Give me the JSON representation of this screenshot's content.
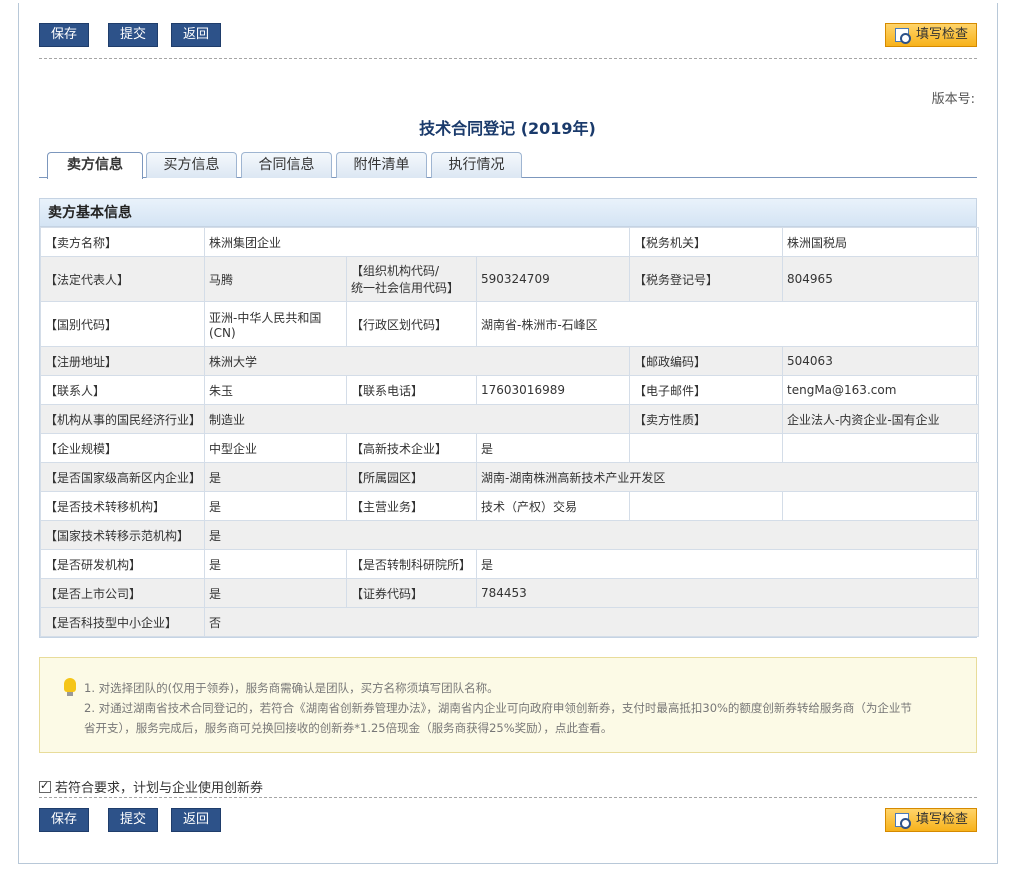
{
  "toolbar": {
    "save": "保存",
    "submit": "提交",
    "back": "返回",
    "check": "填写检查"
  },
  "version_label": "版本号:",
  "title": "技术合同登记 (2019年)",
  "tabs": [
    "卖方信息",
    "买方信息",
    "合同信息",
    "附件清单",
    "执行情况"
  ],
  "panel_title": "卖方基本信息",
  "rows": {
    "r1": {
      "l1": "【卖方名称】",
      "v1": "株洲集团企业",
      "l2": "【税务机关】",
      "v2": "株洲国税局"
    },
    "r2": {
      "l1": "【法定代表人】",
      "v1": "马腾",
      "l2a": "【组织机构代码/",
      "l2b": "统一社会信用代码】",
      "v2": "590324709",
      "l3": "【税务登记号】",
      "v3": "804965"
    },
    "r3": {
      "l1": "【国别代码】",
      "v1": "亚洲-中华人民共和国(CN)",
      "l2": "【行政区划代码】",
      "v2": "湖南省-株洲市-石峰区"
    },
    "r4": {
      "l1": "【注册地址】",
      "v1": "株洲大学",
      "l2": "【邮政编码】",
      "v2": "504063"
    },
    "r5": {
      "l1": "【联系人】",
      "v1": "朱玉",
      "l2": "【联系电话】",
      "v2": "17603016989",
      "l3": "【电子邮件】",
      "v3": "tengMa@163.com"
    },
    "r6": {
      "l1": "【机构从事的国民经济行业】",
      "v1": "制造业",
      "l2": "【卖方性质】",
      "v2": "企业法人-内资企业-国有企业"
    },
    "r7": {
      "l1": "【企业规模】",
      "v1": "中型企业",
      "l2": "【高新技术企业】",
      "v2": "是"
    },
    "r8": {
      "l1": "【是否国家级高新区内企业】",
      "v1": "是",
      "l2": "【所属园区】",
      "v2": "湖南-湖南株洲高新技术产业开发区"
    },
    "r9": {
      "l1": "【是否技术转移机构】",
      "v1": "是",
      "l2": "【主营业务】",
      "v2": "技术（产权）交易"
    },
    "r10": {
      "l1": "【国家技术转移示范机构】",
      "v1": "是"
    },
    "r11": {
      "l1": "【是否研发机构】",
      "v1": "是",
      "l2": "【是否转制科研院所】",
      "v2": "是"
    },
    "r12": {
      "l1": "【是否上市公司】",
      "v1": "是",
      "l2": "【证券代码】",
      "v2": "784453"
    },
    "r13": {
      "l1": "【是否科技型中小企业】",
      "v1": "否"
    }
  },
  "tips": {
    "t1": "1. 对选择团队的(仅用于领券)，服务商需确认是团队，买方名称须填写团队名称。",
    "t2a": "2. 对通过湖南省技术合同登记的，若符合《湖南省创新券管理办法》，湖南省内企业可向政府申领创新券，支付时最高抵扣30%的额度创新券转给服务商（为企业节",
    "t2b": "省开支），服务完成后，服务商可兑换回接收的创新券*1.25倍现金（服务商获得25%奖励），点此查看。"
  },
  "checkbox_label": "若符合要求，计划与企业使用创新券"
}
